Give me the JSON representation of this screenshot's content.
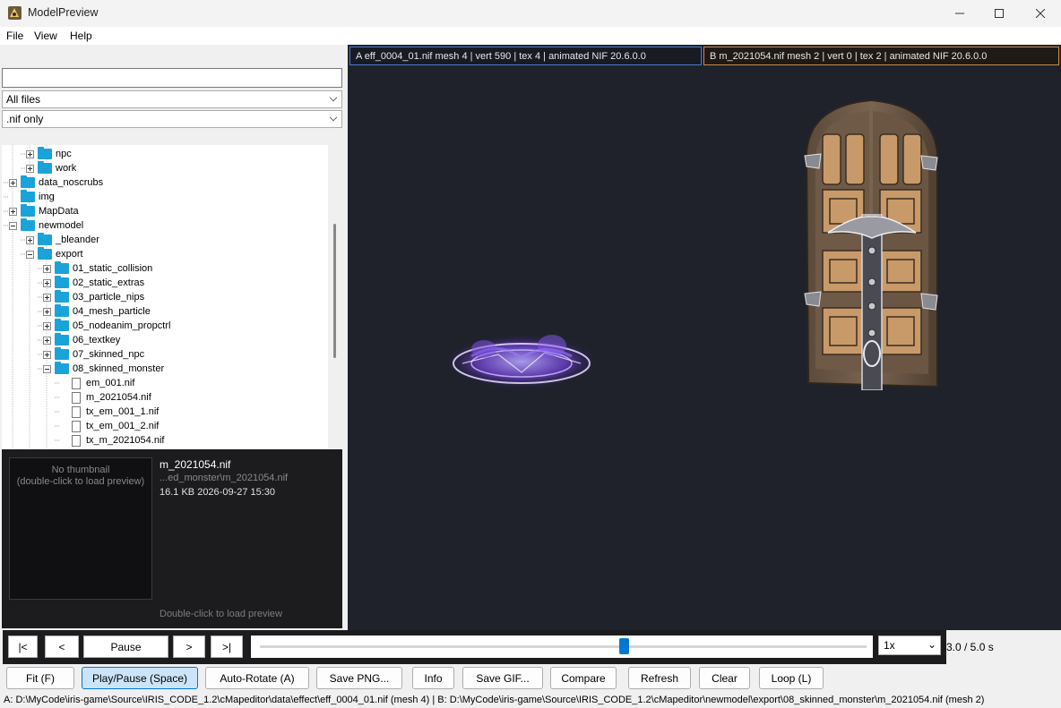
{
  "window": {
    "title": "ModelPreview"
  },
  "menu": [
    "File",
    "View",
    "Help"
  ],
  "filter": {
    "search_value": "",
    "type_select": "All files",
    "ext_select": ".nif only"
  },
  "tree": [
    {
      "label": "npc",
      "kind": "folder",
      "depth": 1,
      "expander": "plus"
    },
    {
      "label": "work",
      "kind": "folder",
      "depth": 1,
      "expander": "plus"
    },
    {
      "label": "data_noscrubs",
      "kind": "folder",
      "depth": 0,
      "expander": "plus"
    },
    {
      "label": "img",
      "kind": "folder",
      "depth": 0,
      "expander": "none"
    },
    {
      "label": "MapData",
      "kind": "folder",
      "depth": 0,
      "expander": "plus"
    },
    {
      "label": "newmodel",
      "kind": "folder",
      "depth": 0,
      "expander": "minus"
    },
    {
      "label": "_bleander",
      "kind": "folder",
      "depth": 1,
      "expander": "plus"
    },
    {
      "label": "export",
      "kind": "folder",
      "depth": 1,
      "expander": "minus"
    },
    {
      "label": "01_static_collision",
      "kind": "folder",
      "depth": 2,
      "expander": "plus"
    },
    {
      "label": "02_static_extras",
      "kind": "folder",
      "depth": 2,
      "expander": "plus"
    },
    {
      "label": "03_particle_nips",
      "kind": "folder",
      "depth": 2,
      "expander": "plus"
    },
    {
      "label": "04_mesh_particle",
      "kind": "folder",
      "depth": 2,
      "expander": "plus"
    },
    {
      "label": "05_nodeanim_propctrl",
      "kind": "folder",
      "depth": 2,
      "expander": "plus"
    },
    {
      "label": "06_textkey",
      "kind": "folder",
      "depth": 2,
      "expander": "plus"
    },
    {
      "label": "07_skinned_npc",
      "kind": "folder",
      "depth": 2,
      "expander": "plus"
    },
    {
      "label": "08_skinned_monster",
      "kind": "folder",
      "depth": 2,
      "expander": "minus"
    },
    {
      "label": "em_001.nif",
      "kind": "file",
      "depth": 3,
      "expander": "none"
    },
    {
      "label": "m_2021054.nif",
      "kind": "file",
      "depth": 3,
      "expander": "none"
    },
    {
      "label": "tx_em_001_1.nif",
      "kind": "file",
      "depth": 3,
      "expander": "none"
    },
    {
      "label": "tx_em_001_2.nif",
      "kind": "file",
      "depth": 3,
      "expander": "none"
    },
    {
      "label": "tx_m_2021054.nif",
      "kind": "file",
      "depth": 3,
      "expander": "none"
    }
  ],
  "details": {
    "thumb_line1": "No thumbnail",
    "thumb_line2": "(double-click to load preview)",
    "filename": "m_2021054.nif",
    "path": "...ed_monster\\m_2021054.nif",
    "meta": "16.1 KB  2026-09-27 15:30",
    "hint": "Double-click to load preview"
  },
  "viewer": {
    "tab_a": "A  eff_0004_01.nif   mesh 4 | vert 590 | tex 4 | animated   NIF 20.6.0.0",
    "tab_b": "B  m_2021054.nif   mesh 2 | vert 0 | tex 2 | animated   NIF 20.6.0.0"
  },
  "playback": {
    "first": "|<",
    "prev": "<",
    "pause": "Pause",
    "next": ">",
    "last": ">|",
    "progress": 0.6,
    "speed": "1x",
    "time": "3.0 / 5.0 s"
  },
  "toolbar": {
    "fit": "Fit (F)",
    "play_pause": "Play/Pause (Space)",
    "auto_rotate": "Auto-Rotate (A)",
    "save_png": "Save PNG...",
    "info": "Info",
    "save_gif": "Save GIF...",
    "compare": "Compare",
    "refresh": "Refresh",
    "clear": "Clear",
    "loop": "Loop (L)"
  },
  "status": "A: D:\\MyCode\\iris-game\\Source\\IRIS_CODE_1.2\\cMapeditor\\data\\effect\\eff_0004_01.nif (mesh 4)   |   B: D:\\MyCode\\iris-game\\Source\\IRIS_CODE_1.2\\cMapeditor\\newmodel\\export\\08_skinned_monster\\m_2021054.nif (mesh 2)"
}
